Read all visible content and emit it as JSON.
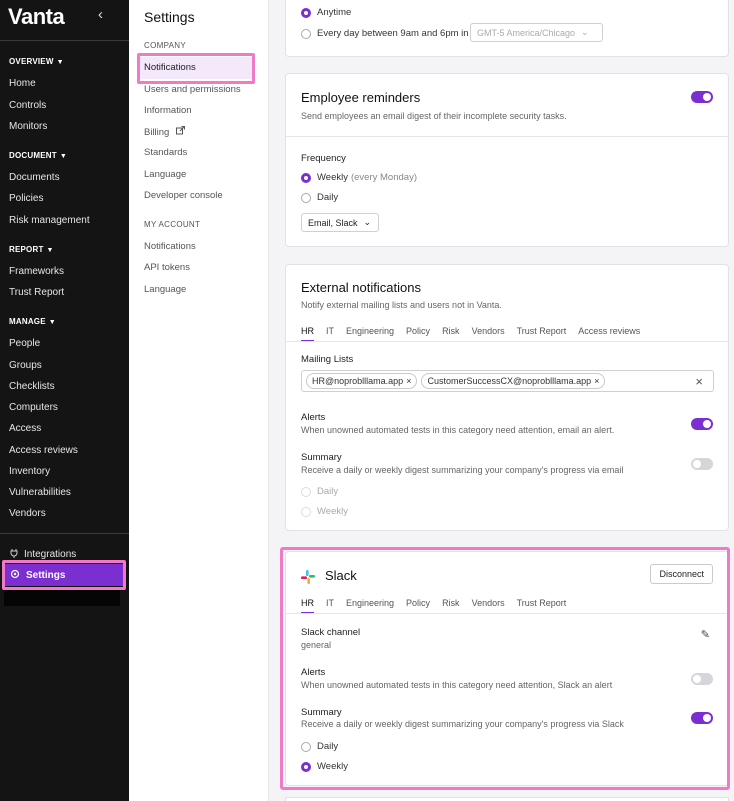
{
  "sidebar": {
    "logo": "Vanta",
    "collapse": "‹",
    "sections": [
      {
        "title": "OVERVIEW",
        "items": [
          "Home",
          "Controls",
          "Monitors"
        ]
      },
      {
        "title": "DOCUMENT",
        "items": [
          "Documents",
          "Policies",
          "Risk management"
        ]
      },
      {
        "title": "REPORT",
        "items": [
          "Frameworks",
          "Trust Report"
        ]
      },
      {
        "title": "MANAGE",
        "items": [
          "People",
          "Groups",
          "Checklists",
          "Computers",
          "Access",
          "Access reviews",
          "Inventory",
          "Vulnerabilities",
          "Vendors"
        ]
      }
    ],
    "integrations": "Integrations",
    "settings": "Settings",
    "accent": "#7b2fd0"
  },
  "subnav": {
    "title": "Settings",
    "company_label": "COMPANY",
    "company_items": [
      "Notifications",
      "Users and permissions",
      "Information",
      "Billing",
      "Standards",
      "Language",
      "Developer console"
    ],
    "account_label": "MY ACCOUNT",
    "account_items": [
      "Notifications",
      "API tokens",
      "Language"
    ]
  },
  "top_card": {
    "anytime": "Anytime",
    "every_day": "Every day between 9am and 6pm in",
    "timezone": "GMT-5 America/Chicago"
  },
  "reminders": {
    "title": "Employee reminders",
    "subtitle": "Send employees an email digest of their incomplete security tasks.",
    "frequency_label": "Frequency",
    "weekly": "Weekly",
    "weekly_note": "(every Monday)",
    "daily": "Daily",
    "channel_select": "Email, Slack"
  },
  "external": {
    "title": "External notifications",
    "subtitle": "Notify external mailing lists and users not in Vanta.",
    "tabs": [
      "HR",
      "IT",
      "Engineering",
      "Policy",
      "Risk",
      "Vendors",
      "Trust Report",
      "Access reviews"
    ],
    "mailing_label": "Mailing Lists",
    "emails": [
      "HR@noproblllama.app",
      "CustomerSuccessCX@noproblllama.app"
    ],
    "alerts_label": "Alerts",
    "alerts_desc": "When unowned automated tests in this category need attention, email an alert.",
    "summary_label": "Summary",
    "summary_desc": "Receive a daily or weekly digest summarizing your company's progress via email",
    "daily": "Daily",
    "weekly": "Weekly"
  },
  "slack": {
    "title": "Slack",
    "disconnect": "Disconnect",
    "tabs": [
      "HR",
      "IT",
      "Engineering",
      "Policy",
      "Risk",
      "Vendors",
      "Trust Report"
    ],
    "channel_label": "Slack channel",
    "channel_value": "general",
    "alerts_label": "Alerts",
    "alerts_desc": "When unowned automated tests in this category need attention, Slack an alert",
    "summary_label": "Summary",
    "summary_desc": "Receive a daily or weekly digest summarizing your company's progress via Slack",
    "daily": "Daily",
    "weekly": "Weekly"
  }
}
